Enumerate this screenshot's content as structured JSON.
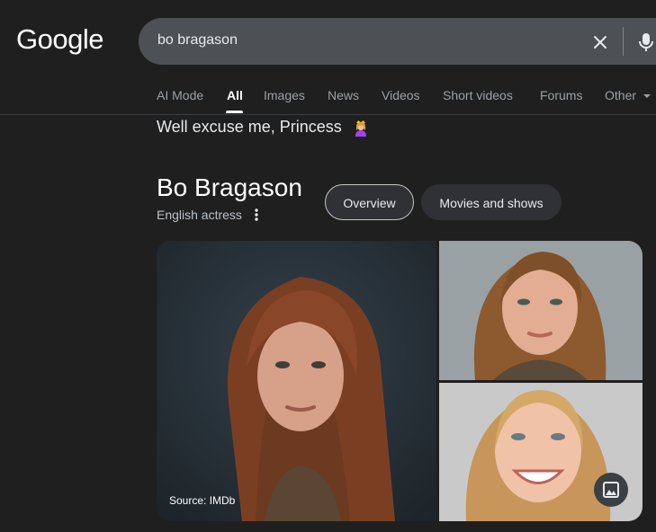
{
  "logo": "Google",
  "search": {
    "query": "bo bragason"
  },
  "tabs": [
    "AI Mode",
    "All",
    "Images",
    "News",
    "Videos",
    "Short videos",
    "Forums",
    "Other"
  ],
  "headline": "Well excuse me, Princess",
  "entity": {
    "name": "Bo Bragason",
    "description": "English actress",
    "chips": {
      "overview": "Overview",
      "movies": "Movies and shows"
    }
  },
  "images": {
    "source": "Source: IMDb"
  },
  "colors": {
    "background": "#1f1f1f",
    "search_bar": "#4d5156",
    "chip": "#303134"
  },
  "icons": [
    "close-icon",
    "mic-icon",
    "chevron-down-icon",
    "princess-emoji-icon",
    "more-vert-icon",
    "image-icon"
  ]
}
